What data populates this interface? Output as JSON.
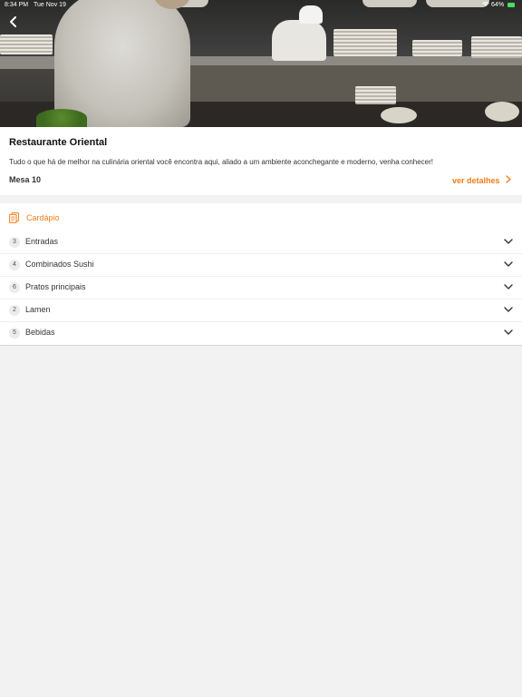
{
  "status_bar": {
    "time": "8:34 PM",
    "date": "Tue Nov 19",
    "battery": "64%"
  },
  "restaurant": {
    "name": "Restaurante Oriental",
    "description": "Tudo o que há de melhor na culinária oriental você encontra aqui, aliado a um ambiente aconchegante e moderno, venha conhecer!",
    "table_label": "Mesa 10",
    "details_link": "ver detalhes"
  },
  "menu": {
    "title": "Cardápio",
    "categories": [
      {
        "count": "3",
        "name": "Entradas"
      },
      {
        "count": "4",
        "name": "Combinados Sushi"
      },
      {
        "count": "6",
        "name": "Pratos principais"
      },
      {
        "count": "2",
        "name": "Lamen"
      },
      {
        "count": "5",
        "name": "Bebidas"
      }
    ]
  },
  "colors": {
    "accent": "#f07d1a",
    "background": "#f2f2f2"
  }
}
